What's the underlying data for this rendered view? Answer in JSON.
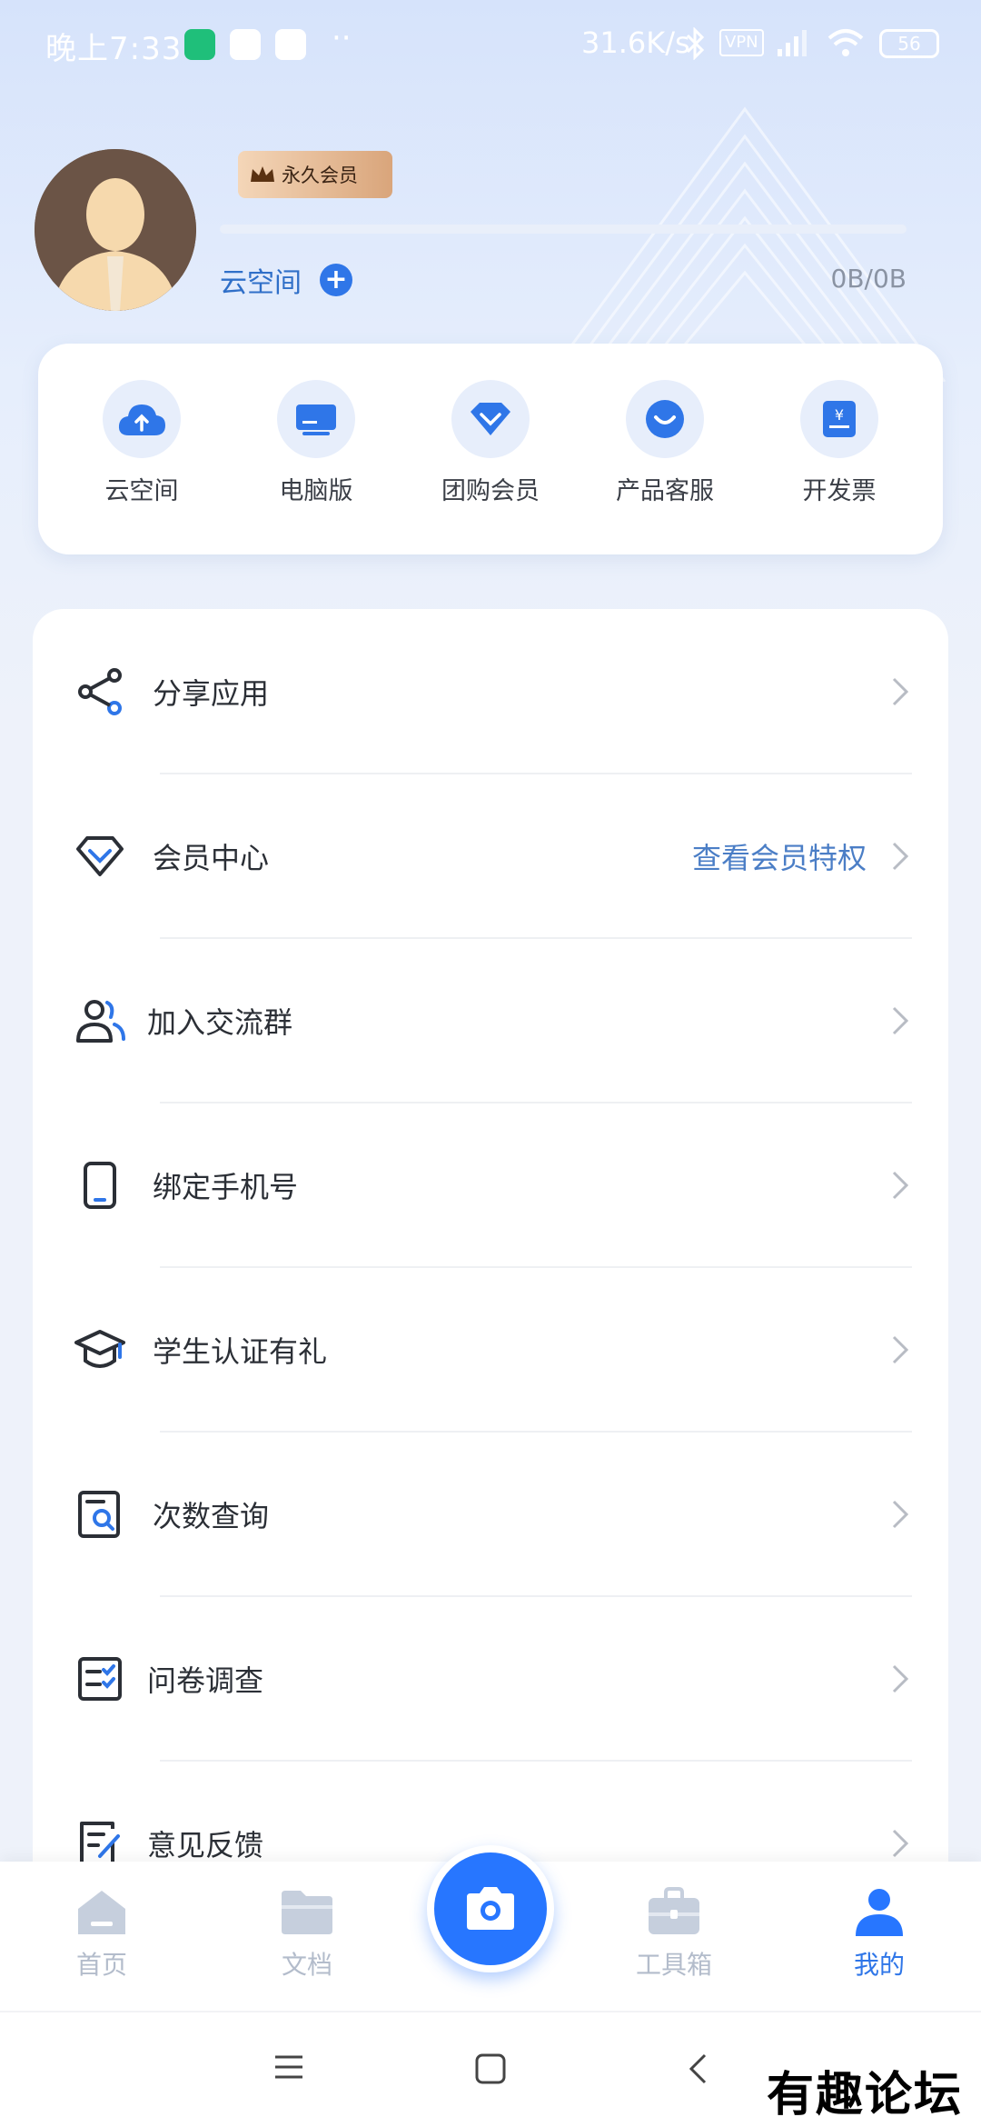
{
  "status_bar": {
    "time": "晚上7:33",
    "dots": "··",
    "net_speed": "31.6K/s",
    "vpn": "VPN",
    "battery": "56"
  },
  "profile": {
    "badge": "永久会员",
    "cloud_label": "云空间",
    "storage": "0B/0B",
    "storage_used_fraction": 0
  },
  "quick_actions": [
    {
      "label": "云空间",
      "icon": "cloud-upload-icon"
    },
    {
      "label": "电脑版",
      "icon": "monitor-icon"
    },
    {
      "label": "团购会员",
      "icon": "diamond-icon"
    },
    {
      "label": "产品客服",
      "icon": "support-chat-icon"
    },
    {
      "label": "开发票",
      "icon": "invoice-icon"
    }
  ],
  "menu": [
    {
      "label": "分享应用",
      "icon": "share-icon"
    },
    {
      "label": "会员中心",
      "icon": "diamond-icon",
      "extra": "查看会员特权"
    },
    {
      "label": "加入交流群",
      "icon": "group-icon"
    },
    {
      "label": "绑定手机号",
      "icon": "phone-icon"
    },
    {
      "label": "学生认证有礼",
      "icon": "graduation-cap-icon"
    },
    {
      "label": "次数查询",
      "icon": "search-document-icon"
    },
    {
      "label": "问卷调查",
      "icon": "checklist-icon"
    },
    {
      "label": "意见反馈",
      "icon": "feedback-icon"
    }
  ],
  "bottom_nav": [
    {
      "label": "首页",
      "icon": "home-icon"
    },
    {
      "label": "文档",
      "icon": "folder-icon"
    },
    {
      "label": "",
      "icon": "camera-icon"
    },
    {
      "label": "工具箱",
      "icon": "toolbox-icon"
    },
    {
      "label": "我的",
      "icon": "user-icon",
      "active": true
    }
  ],
  "colors": {
    "accent": "#2776ff",
    "link": "#4b7ec6",
    "inactive": "#b3bccb"
  },
  "watermark": "有趣论坛"
}
